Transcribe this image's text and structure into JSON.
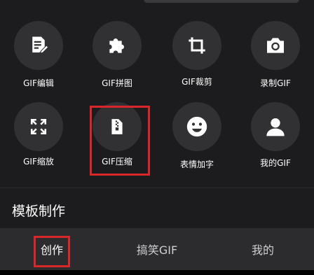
{
  "tools": [
    {
      "label": "GIF编辑",
      "icon": "edit-document-icon"
    },
    {
      "label": "GIF拼图",
      "icon": "puzzle-icon"
    },
    {
      "label": "GIF裁剪",
      "icon": "crop-icon"
    },
    {
      "label": "录制GIF",
      "icon": "camera-icon"
    },
    {
      "label": "GIF缩放",
      "icon": "expand-arrows-icon"
    },
    {
      "label": "GIF压缩",
      "icon": "zip-file-icon"
    },
    {
      "label": "表情加字",
      "icon": "smiley-face-icon"
    },
    {
      "label": "我的GIF",
      "icon": "person-icon"
    }
  ],
  "section": {
    "title": "模板制作"
  },
  "bottom_nav": {
    "tabs": [
      {
        "label": "创作",
        "active": true
      },
      {
        "label": "搞笑GIF",
        "active": false
      },
      {
        "label": "我的",
        "active": false
      }
    ]
  },
  "colors": {
    "background": "#1c1c1e",
    "circle": "#313133",
    "nav_background": "#2c2c2e",
    "highlight": "#d7272a",
    "active_text": "#ffffff",
    "inactive_text": "#cfcfd1"
  }
}
